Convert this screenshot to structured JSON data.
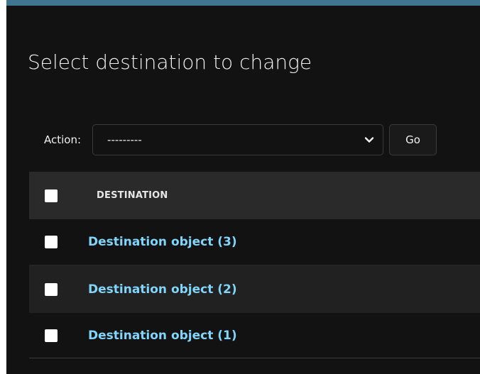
{
  "page": {
    "title": "Select destination to change"
  },
  "actions": {
    "label": "Action:",
    "selected": "---------",
    "go_label": "Go"
  },
  "table": {
    "column_header": "DESTINATION",
    "rows": [
      {
        "label": "Destination object (3)"
      },
      {
        "label": "Destination object (2)"
      },
      {
        "label": "Destination object (1)"
      }
    ]
  },
  "colors": {
    "background": "#121212",
    "top_border": "#417690",
    "link": "#81d4fa",
    "header_row": "#2a2a2a",
    "alt_row": "#212121"
  },
  "icons": {
    "select": "chevron-down-icon"
  }
}
